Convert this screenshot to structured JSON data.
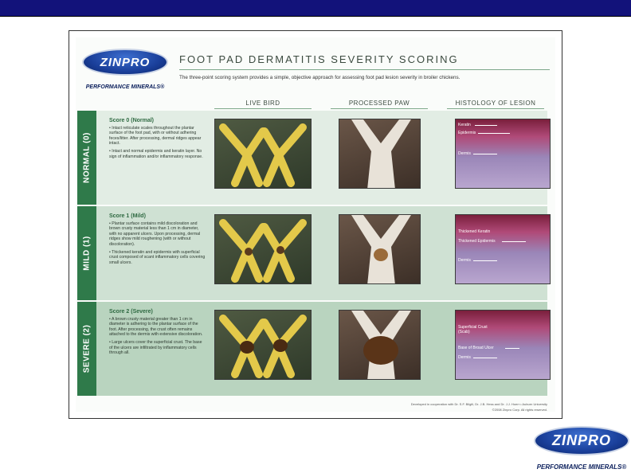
{
  "poster": {
    "title": "FOOT PAD DERMATITIS SEVERITY SCORING",
    "subtitle": "The three-point scoring system provides a simple, objective approach for assessing foot pad lesion severity in broiler chickens.",
    "columns": [
      "LIVE BIRD",
      "PROCESSED PAW",
      "HISTOLOGY OF LESION"
    ],
    "rows": [
      {
        "band": "NORMAL (0)",
        "score": "Score 0 (Normal)",
        "bullets": [
          "• Intact reticulate scales throughout the plantar surface of the foot pad, with or without adhering feces/litter. After processing, dermal ridges appear intact.",
          "• Intact and normal epidermis and keratin layer. No sign of inflammation and/or inflammatory response."
        ],
        "histo_labels": [
          "Keratin",
          "Epidermis",
          "Dermis"
        ]
      },
      {
        "band": "MILD (1)",
        "score": "Score 1 (Mild)",
        "bullets": [
          "• Plantar surface contains mild discoloration and brown crusty material less than 1 cm in diameter, with no apparent ulcers. Upon processing, dermal ridges show mild roughening (with or without discoloration).",
          "• Thickened keratin and epidermis with superficial crust composed of scant inflammatory cells covering small ulcers."
        ],
        "histo_labels": [
          "Thickened Keratin",
          "Thickened Epidermis",
          "Dermis"
        ]
      },
      {
        "band": "SEVERE (2)",
        "score": "Score 2 (Severe)",
        "bullets": [
          "• A brown crusty material greater than 1 cm in diameter is adhering to the plantar surface of the foot. After processing, the crust often remains attached to the dermis with extensive discoloration.",
          "• Large ulcers cover the superficial crust. The base of the ulcers are infiltrated by inflammatory cells through all."
        ],
        "histo_labels": [
          "Superficial Crust (Scab)",
          "Base of Broad Ulcer",
          "Dermis"
        ]
      }
    ],
    "footer_1": "Developed in cooperation with Dr. S.F. Bilgili, Dr. J.B. Hess and Dr. J.J. Hoerr • Auburn University",
    "footer_2": "©2008 Zinpro Corp. All rights reserved."
  },
  "logos": {
    "brand": "ZINPRO",
    "tagline": "PERFORMANCE MINERALS®"
  },
  "colors": {
    "top_bar": "#12127a",
    "band_green": "#2f7a4a",
    "logo_blue": "#1a3f9a"
  }
}
